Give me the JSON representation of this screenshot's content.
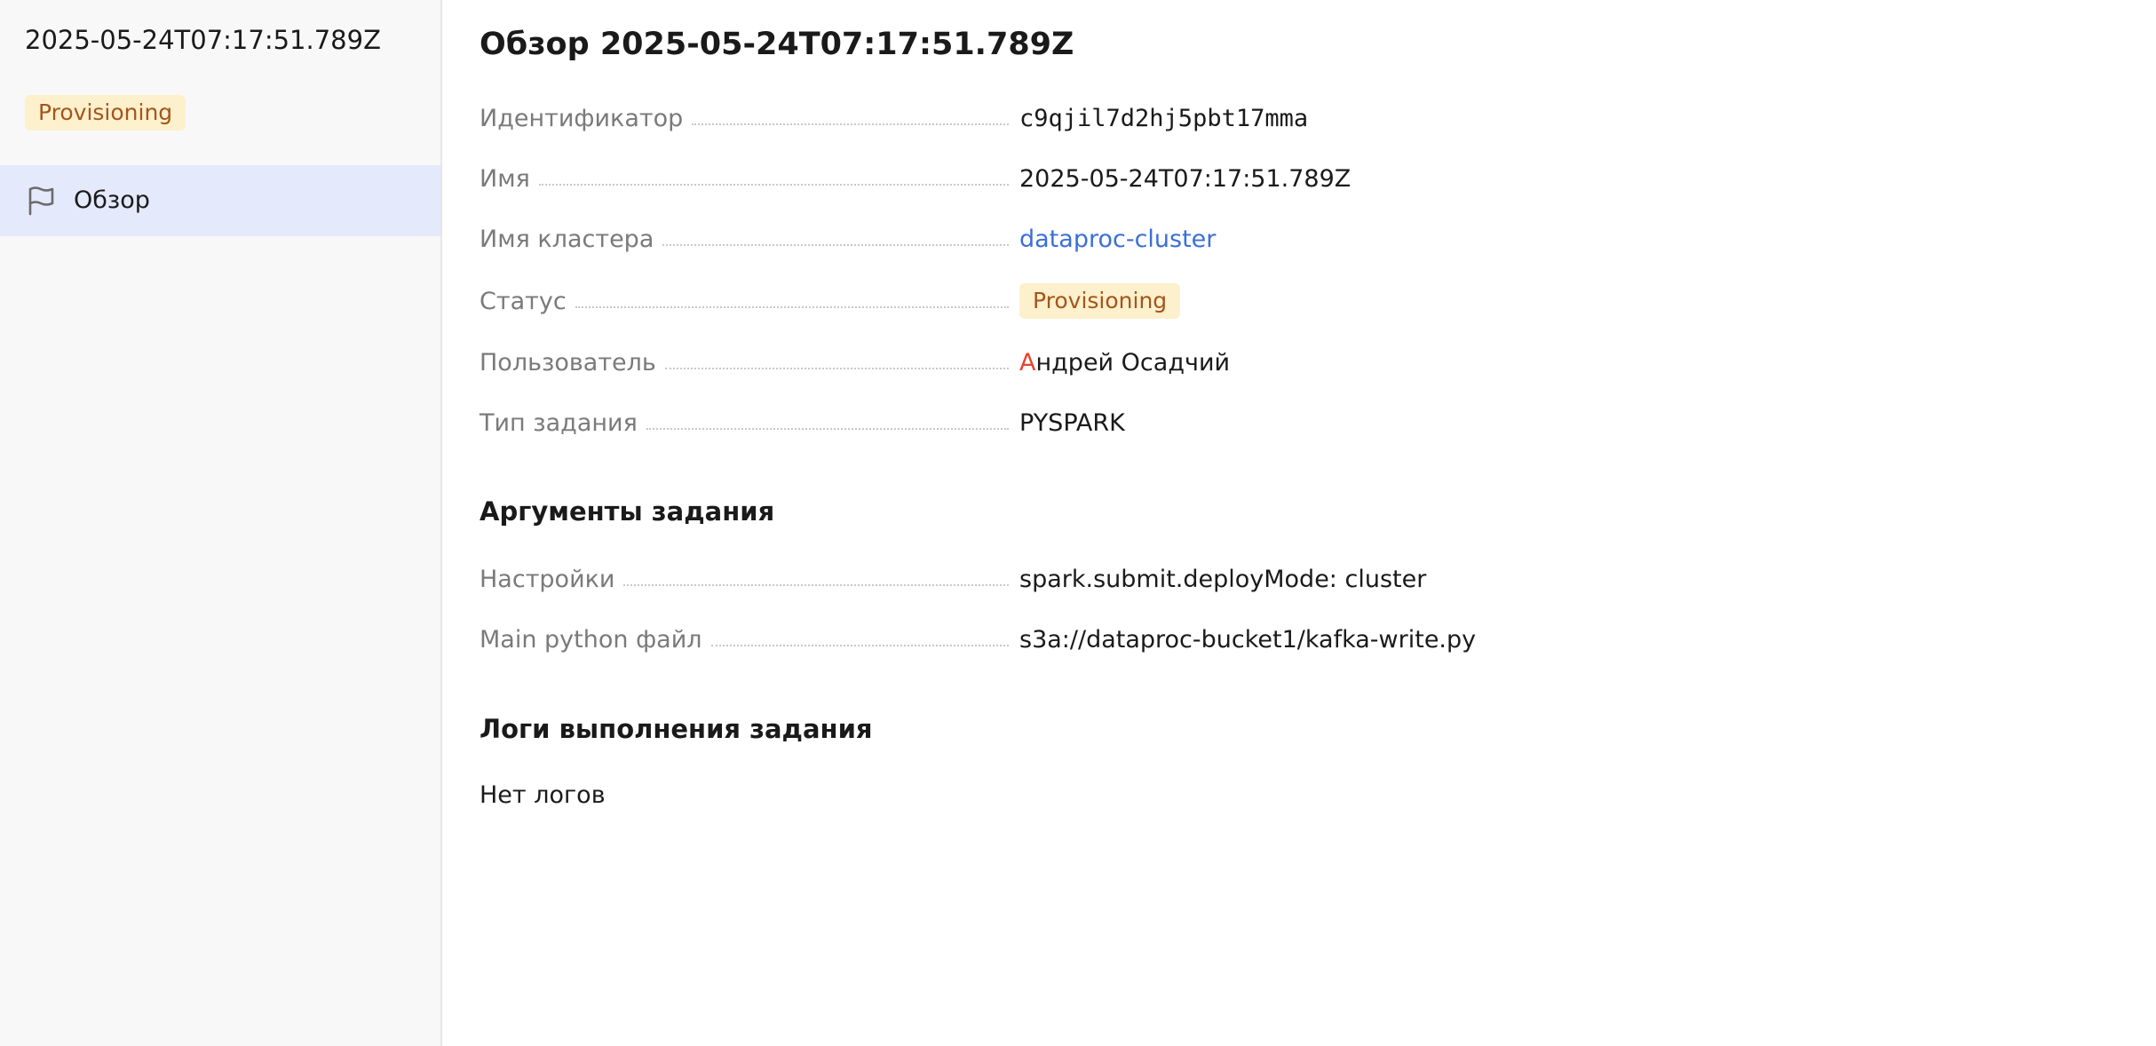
{
  "sidebar": {
    "title": "2025-05-24T07:17:51.789Z",
    "status_badge": "Provisioning",
    "nav": [
      {
        "label": "Обзор",
        "icon": "flag-icon",
        "active": true
      }
    ]
  },
  "main": {
    "title": "Обзор 2025-05-24T07:17:51.789Z",
    "fields": [
      {
        "key": "Идентификатор",
        "value": "c9qjil7d2hj5pbt17mma"
      },
      {
        "key": "Имя",
        "value": "2025-05-24T07:17:51.789Z"
      },
      {
        "key": "Имя кластера",
        "value": "dataproc-cluster"
      },
      {
        "key": "Статус",
        "value": "Provisioning"
      },
      {
        "key": "Пользователь",
        "avatar_letter": "А",
        "value_rest": "ндрей Осадчий"
      },
      {
        "key": "Тип задания",
        "value": "PYSPARK"
      }
    ],
    "args_section": {
      "title": "Аргументы задания",
      "fields": [
        {
          "key": "Настройки",
          "value": "spark.submit.deployMode: cluster"
        },
        {
          "key": "Main python файл",
          "value": "s3a://dataproc-bucket1/kafka-write.py"
        }
      ]
    },
    "logs_section": {
      "title": "Логи выполнения задания",
      "empty_text": "Нет логов"
    }
  },
  "colors": {
    "sidebar_bg": "#f8f8f8",
    "nav_active_bg": "#e4e9fb",
    "badge_bg": "#fdf0cc",
    "badge_text": "#a4551c",
    "link": "#3a6fd8",
    "avatar_letter": "#e5432e",
    "key_text": "#7a7a7a"
  }
}
